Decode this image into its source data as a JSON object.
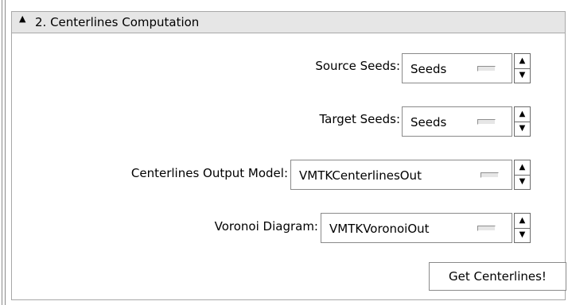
{
  "section": {
    "number_title": "2. Centerlines Computation"
  },
  "fields": {
    "source_seeds": {
      "label": "Source Seeds:",
      "value": "Seeds"
    },
    "target_seeds": {
      "label": "Target Seeds:",
      "value": "Seeds"
    },
    "centerlines_output_model": {
      "label": "Centerlines Output Model:",
      "value": "VMTKCenterlinesOut"
    },
    "voronoi_diagram": {
      "label": "Voronoi Diagram:",
      "value": "VMTKVoronoiOut"
    }
  },
  "buttons": {
    "get_centerlines": "Get Centerlines!"
  },
  "icons": {
    "collapse": "triangle-up-icon",
    "spin_up": "arrow-up-icon",
    "spin_down": "arrow-down-icon",
    "menu_indicator": "option-menu-indicator-icon"
  },
  "colors": {
    "header_bg": "#e6e6e6",
    "border": "#a8a8a8",
    "background": "#ffffff"
  }
}
